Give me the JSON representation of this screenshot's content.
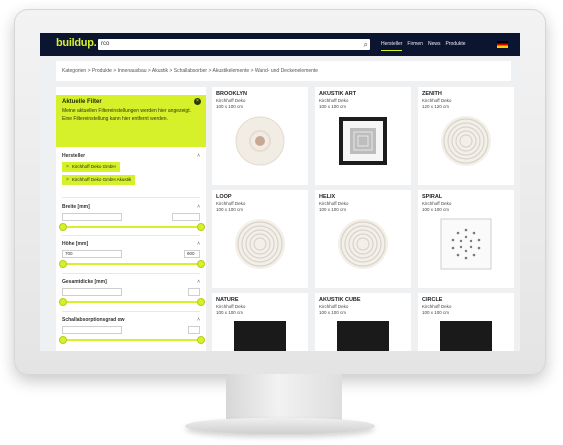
{
  "header": {
    "logo": "buildup.",
    "search_value": "rco",
    "nav": [
      "Hersteller",
      "Firmen",
      "News",
      "Produkte"
    ]
  },
  "breadcrumb": "Kategorien > Produkte > Innenausbau > Akustik > Schallabsorber > Akustikelemente > Wand- und Deckenelemente",
  "filters": {
    "notice_title": "Aktuelle Filter",
    "notice_text": "Meine aktuellen Filtereinstellungen werden hier angezeigt. Eine Filtereinstellung kann hier entfernt werden.",
    "groups": [
      {
        "label": "Hersteller",
        "chips": [
          "Kirchhoff Deko GmbH",
          "Kirchhoff Deko GmbH Akustik"
        ]
      },
      {
        "label": "Breite [mm]",
        "min": "",
        "max": ""
      },
      {
        "label": "Höhe [mm]",
        "min": "700",
        "max": "900"
      },
      {
        "label": "Gesamtdicke [mm]",
        "min": "",
        "max": ""
      },
      {
        "label": "Schallabsorptionsgrad αw",
        "min": "",
        "max": ""
      }
    ]
  },
  "products": [
    {
      "name": "BROOKLYN",
      "line1": "Kirchhoff Deko",
      "line2": "100 x 100 cm",
      "img": "disc"
    },
    {
      "name": "AKUSTIK ART",
      "line1": "Kirchhoff Deko",
      "line2": "100 x 100 cm",
      "img": "frame"
    },
    {
      "name": "ZENITH",
      "line1": "Kirchhoff Deko",
      "line2": "120 x 120 cm",
      "img": "rings"
    },
    {
      "name": "LOOP",
      "line1": "Kirchhoff Deko",
      "line2": "100 x 100 cm",
      "img": "rings"
    },
    {
      "name": "HELIX",
      "line1": "Kirchhoff Deko",
      "line2": "100 x 100 cm",
      "img": "rings"
    },
    {
      "name": "SPIRAL",
      "line1": "Kirchhoff Deko",
      "line2": "100 x 100 cm",
      "img": "dots"
    },
    {
      "name": "NATURE",
      "line1": "Kirchhoff Deko",
      "line2": "100 x 100 cm",
      "img": "dark"
    },
    {
      "name": "AKUSTIK CUBE",
      "line1": "Kirchhoff Deko",
      "line2": "100 x 100 cm",
      "img": "dark"
    },
    {
      "name": "CIRCLE",
      "line1": "Kirchhoff Deko",
      "line2": "100 x 100 cm",
      "img": "dark"
    }
  ],
  "colors": {
    "accent": "#d6f02a",
    "header_bg": "#0c1530"
  }
}
